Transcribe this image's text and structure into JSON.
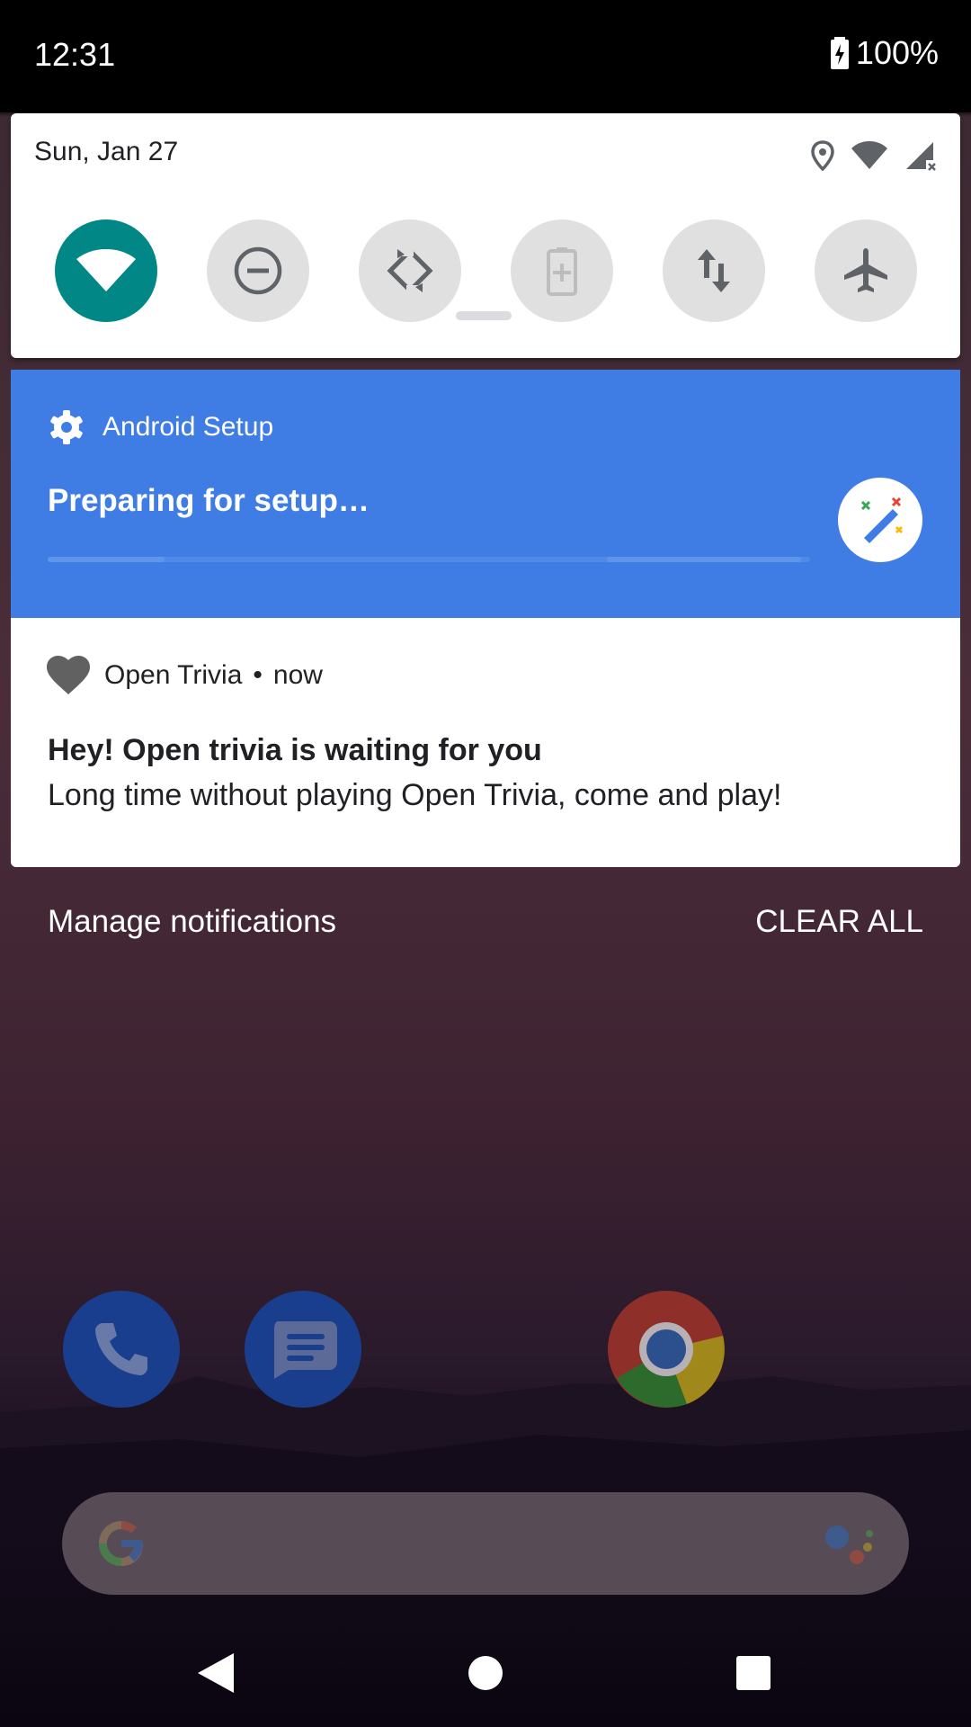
{
  "status_bar": {
    "time": "12:31",
    "battery_percent": "100%",
    "battery_icon": "battery-charging-icon"
  },
  "quick_settings": {
    "date": "Sun, Jan 27",
    "status_icons": [
      "location-icon",
      "wifi-icon",
      "cellular-no-signal-icon"
    ],
    "tiles": [
      {
        "name": "wifi-icon",
        "active": true
      },
      {
        "name": "do-not-disturb-icon",
        "active": false
      },
      {
        "name": "auto-rotate-icon",
        "active": false
      },
      {
        "name": "battery-saver-icon",
        "active": false
      },
      {
        "name": "mobile-data-icon",
        "active": false
      },
      {
        "name": "airplane-mode-icon",
        "active": false
      }
    ],
    "active_color": "#018786"
  },
  "setup_notification": {
    "app_name": "Android Setup",
    "title": "Preparing for setup…",
    "background_color": "#3f7de4",
    "icon": "magic-wand-icon"
  },
  "trivia_notification": {
    "app_name": "Open Trivia",
    "separator": "•",
    "time": "now",
    "headline": "Hey! Open trivia is waiting for you",
    "body": "Long time without playing Open Trivia, come and play!",
    "icon": "heart-icon"
  },
  "footer": {
    "manage_label": "Manage notifications",
    "clear_label": "CLEAR ALL"
  },
  "dock": {
    "apps": [
      "phone-icon",
      "messages-icon",
      "chrome-icon"
    ]
  },
  "search_bar": {
    "left_icon": "google-g-icon",
    "right_icon": "google-assistant-icon"
  },
  "nav_bar": {
    "buttons": [
      "back-button",
      "home-button",
      "recents-button"
    ]
  }
}
